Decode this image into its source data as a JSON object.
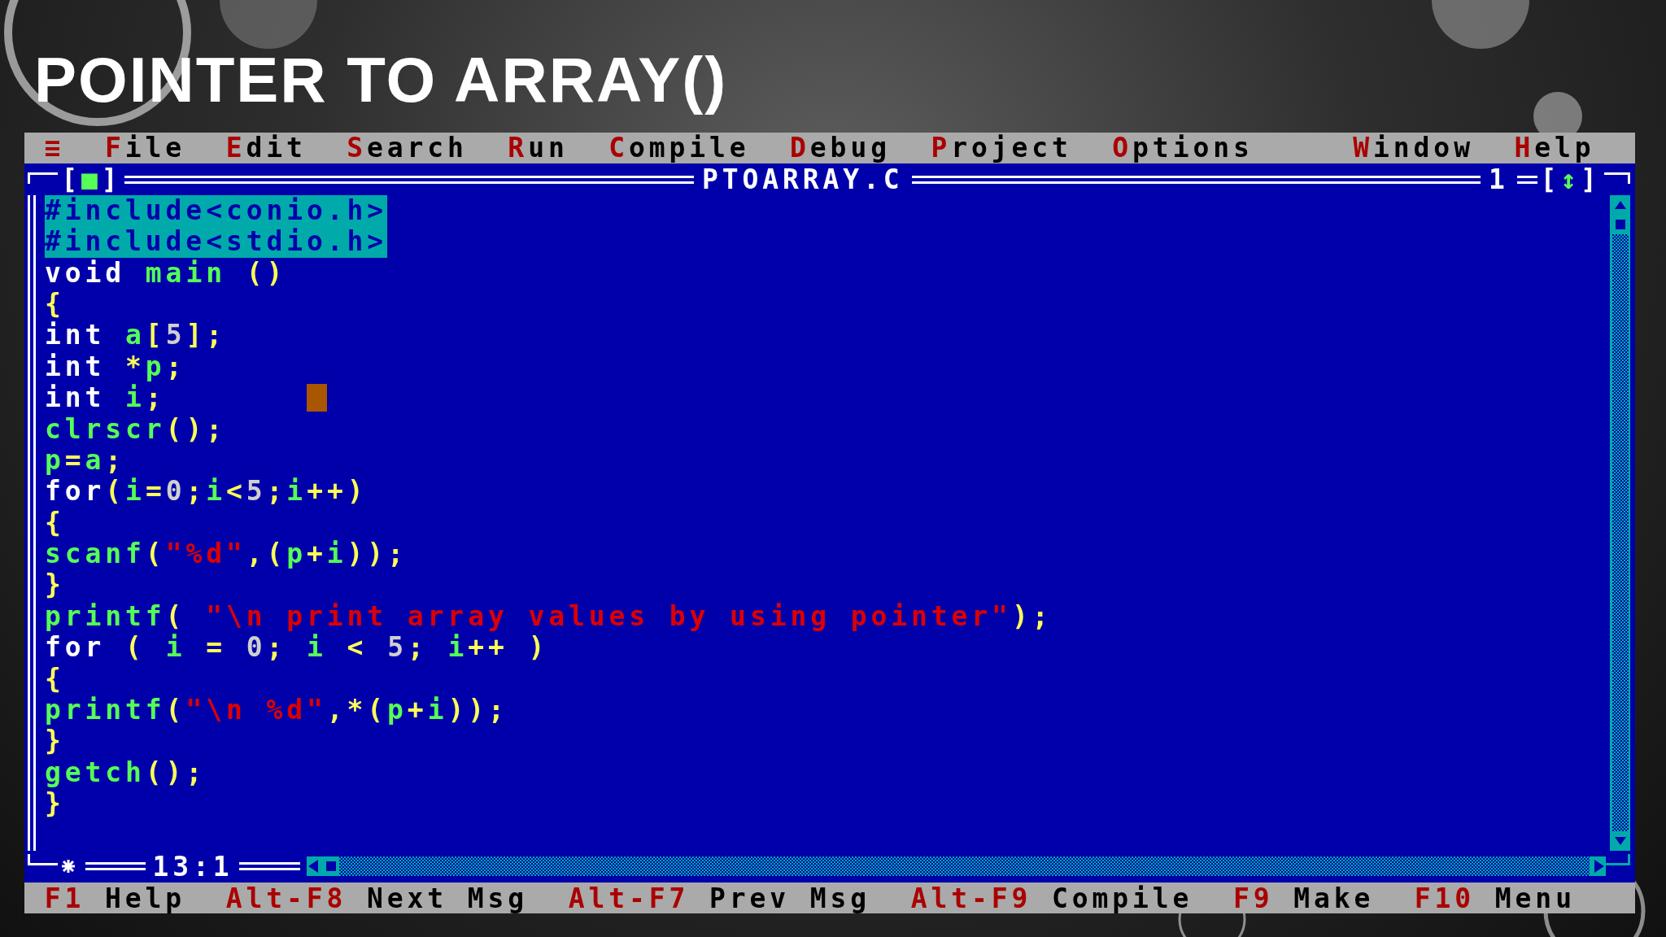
{
  "slide_title": "POINTER TO ARRAY()",
  "menu": [
    {
      "label": "≡",
      "kind": "system"
    },
    {
      "label": "File",
      "kind": "menu"
    },
    {
      "label": "Edit",
      "kind": "menu"
    },
    {
      "label": "Search",
      "kind": "menu"
    },
    {
      "label": "Run",
      "kind": "menu"
    },
    {
      "label": "Compile",
      "kind": "menu"
    },
    {
      "label": "Debug",
      "kind": "menu"
    },
    {
      "label": "Project",
      "kind": "menu"
    },
    {
      "label": "Options",
      "kind": "menu"
    },
    {
      "label": "Window",
      "kind": "menu"
    },
    {
      "label": "Help",
      "kind": "menu"
    }
  ],
  "editor": {
    "close_box": "[■]",
    "title": "PTOARRAY.C",
    "window_number": "1",
    "zoom_box": "[↕]",
    "position": "13:1",
    "modified": true,
    "lines": [
      {
        "selected": true,
        "cursor": false,
        "tokens": [
          {
            "kind": "pp",
            "text": "#include<conio.h>"
          }
        ]
      },
      {
        "selected": true,
        "cursor": false,
        "tokens": [
          {
            "kind": "pp",
            "text": "#include<stdio.h>"
          }
        ]
      },
      {
        "selected": false,
        "cursor": false,
        "tokens": [
          {
            "kind": "kw",
            "text": "void "
          },
          {
            "kind": "id",
            "text": "main"
          },
          {
            "kind": "op",
            "text": " ()"
          }
        ]
      },
      {
        "selected": false,
        "cursor": false,
        "tokens": [
          {
            "kind": "op",
            "text": "{"
          }
        ]
      },
      {
        "selected": false,
        "cursor": false,
        "tokens": [
          {
            "kind": "kw",
            "text": "int "
          },
          {
            "kind": "id",
            "text": "a"
          },
          {
            "kind": "op",
            "text": "["
          },
          {
            "kind": "num",
            "text": "5"
          },
          {
            "kind": "op",
            "text": "];"
          }
        ]
      },
      {
        "selected": false,
        "cursor": false,
        "tokens": [
          {
            "kind": "kw",
            "text": "int"
          },
          {
            "kind": "op",
            "text": " *"
          },
          {
            "kind": "id",
            "text": "p"
          },
          {
            "kind": "op",
            "text": ";"
          }
        ]
      },
      {
        "selected": false,
        "cursor": true,
        "tokens": [
          {
            "kind": "kw",
            "text": "int "
          },
          {
            "kind": "id",
            "text": "i"
          },
          {
            "kind": "op",
            "text": ";"
          }
        ]
      },
      {
        "selected": false,
        "cursor": false,
        "tokens": [
          {
            "kind": "id",
            "text": "clrscr"
          },
          {
            "kind": "op",
            "text": "();"
          }
        ]
      },
      {
        "selected": false,
        "cursor": false,
        "tokens": [
          {
            "kind": "id",
            "text": "p"
          },
          {
            "kind": "op",
            "text": "="
          },
          {
            "kind": "id",
            "text": "a"
          },
          {
            "kind": "op",
            "text": ";"
          }
        ]
      },
      {
        "selected": false,
        "cursor": false,
        "tokens": [
          {
            "kind": "kw",
            "text": "for"
          },
          {
            "kind": "op",
            "text": "("
          },
          {
            "kind": "id",
            "text": "i"
          },
          {
            "kind": "op",
            "text": "="
          },
          {
            "kind": "num",
            "text": "0"
          },
          {
            "kind": "op",
            "text": ";"
          },
          {
            "kind": "id",
            "text": "i"
          },
          {
            "kind": "op",
            "text": "<"
          },
          {
            "kind": "num",
            "text": "5"
          },
          {
            "kind": "op",
            "text": ";"
          },
          {
            "kind": "id",
            "text": "i"
          },
          {
            "kind": "op",
            "text": "++)"
          }
        ]
      },
      {
        "selected": false,
        "cursor": false,
        "tokens": [
          {
            "kind": "op",
            "text": "{"
          }
        ]
      },
      {
        "selected": false,
        "cursor": false,
        "tokens": [
          {
            "kind": "id",
            "text": "scanf"
          },
          {
            "kind": "op",
            "text": "("
          },
          {
            "kind": "str",
            "text": "\"%d\""
          },
          {
            "kind": "op",
            "text": ",("
          },
          {
            "kind": "id",
            "text": "p"
          },
          {
            "kind": "op",
            "text": "+"
          },
          {
            "kind": "id",
            "text": "i"
          },
          {
            "kind": "op",
            "text": "));"
          }
        ]
      },
      {
        "selected": false,
        "cursor": false,
        "tokens": [
          {
            "kind": "op",
            "text": "}"
          }
        ]
      },
      {
        "selected": false,
        "cursor": false,
        "tokens": [
          {
            "kind": "id",
            "text": "printf"
          },
          {
            "kind": "op",
            "text": "( "
          },
          {
            "kind": "str",
            "text": "\"\\n print array values by using pointer\""
          },
          {
            "kind": "op",
            "text": ");"
          }
        ]
      },
      {
        "selected": false,
        "cursor": false,
        "tokens": [
          {
            "kind": "kw",
            "text": "for"
          },
          {
            "kind": "op",
            "text": " ( "
          },
          {
            "kind": "id",
            "text": "i"
          },
          {
            "kind": "op",
            "text": " = "
          },
          {
            "kind": "num",
            "text": "0"
          },
          {
            "kind": "op",
            "text": "; "
          },
          {
            "kind": "id",
            "text": "i"
          },
          {
            "kind": "op",
            "text": " < "
          },
          {
            "kind": "num",
            "text": "5"
          },
          {
            "kind": "op",
            "text": "; "
          },
          {
            "kind": "id",
            "text": "i"
          },
          {
            "kind": "op",
            "text": "++ )"
          }
        ]
      },
      {
        "selected": false,
        "cursor": false,
        "tokens": [
          {
            "kind": "op",
            "text": "{"
          }
        ]
      },
      {
        "selected": false,
        "cursor": false,
        "tokens": [
          {
            "kind": "id",
            "text": "printf"
          },
          {
            "kind": "op",
            "text": "("
          },
          {
            "kind": "str",
            "text": "\"\\n %d\""
          },
          {
            "kind": "op",
            "text": ",*("
          },
          {
            "kind": "id",
            "text": "p"
          },
          {
            "kind": "op",
            "text": "+"
          },
          {
            "kind": "id",
            "text": "i"
          },
          {
            "kind": "op",
            "text": "));"
          }
        ]
      },
      {
        "selected": false,
        "cursor": false,
        "tokens": [
          {
            "kind": "op",
            "text": "}"
          }
        ]
      },
      {
        "selected": false,
        "cursor": false,
        "tokens": [
          {
            "kind": "id",
            "text": "getch"
          },
          {
            "kind": "op",
            "text": "();"
          }
        ]
      },
      {
        "selected": false,
        "cursor": false,
        "tokens": [
          {
            "kind": "op",
            "text": "}"
          }
        ]
      }
    ]
  },
  "status_bar": [
    {
      "key": "F1",
      "label": "Help"
    },
    {
      "key": "Alt-F8",
      "label": "Next Msg"
    },
    {
      "key": "Alt-F7",
      "label": "Prev Msg"
    },
    {
      "key": "Alt-F9",
      "label": "Compile"
    },
    {
      "key": "F9",
      "label": "Make"
    },
    {
      "key": "F10",
      "label": "Menu"
    }
  ]
}
